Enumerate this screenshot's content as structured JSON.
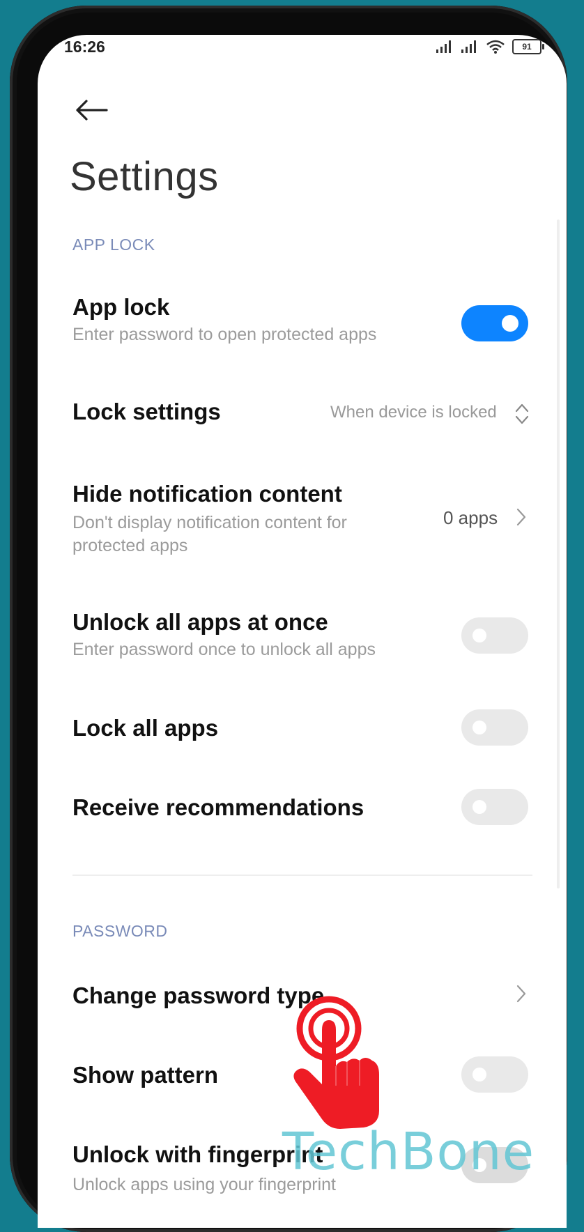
{
  "status_bar": {
    "time": "16:26",
    "battery": "91",
    "icons": [
      "signal-icon",
      "signal-icon",
      "wifi-icon",
      "battery-icon"
    ]
  },
  "header": {
    "back_icon": "arrow-left-icon",
    "title": "Settings"
  },
  "sections": {
    "app_lock": {
      "header": "APP LOCK",
      "app_lock": {
        "title": "App lock",
        "subtitle": "Enter password to open protected apps",
        "toggle_on": true
      },
      "lock_settings": {
        "title": "Lock settings",
        "value": "When device is locked",
        "icon": "chevron-up-down-icon"
      },
      "hide_notification": {
        "title": "Hide notification content",
        "subtitle": "Don't display notification content for protected apps",
        "value": "0 apps",
        "icon": "chevron-right-icon"
      },
      "unlock_all": {
        "title": "Unlock all apps at once",
        "subtitle": "Enter password once to unlock all apps",
        "toggle_on": false
      },
      "lock_all": {
        "title": "Lock all apps",
        "toggle_on": false
      },
      "recommendations": {
        "title": "Receive recommendations",
        "toggle_on": false
      }
    },
    "password": {
      "header": "PASSWORD",
      "change_type": {
        "title": "Change password type",
        "icon": "chevron-right-icon"
      },
      "show_pattern": {
        "title": "Show pattern",
        "toggle_on": false
      },
      "fingerprint": {
        "title": "Unlock with fingerprint",
        "subtitle": "Unlock apps using your fingerprint"
      }
    }
  },
  "overlay": {
    "tap_icon": "tap-hand-icon",
    "watermark": "TechBone"
  },
  "colors": {
    "background": "#137d8e",
    "accent": "#0d84ff",
    "section_header": "#7a8bb8",
    "tap_hand": "#ee1c25",
    "watermark": "#62c6d4"
  }
}
